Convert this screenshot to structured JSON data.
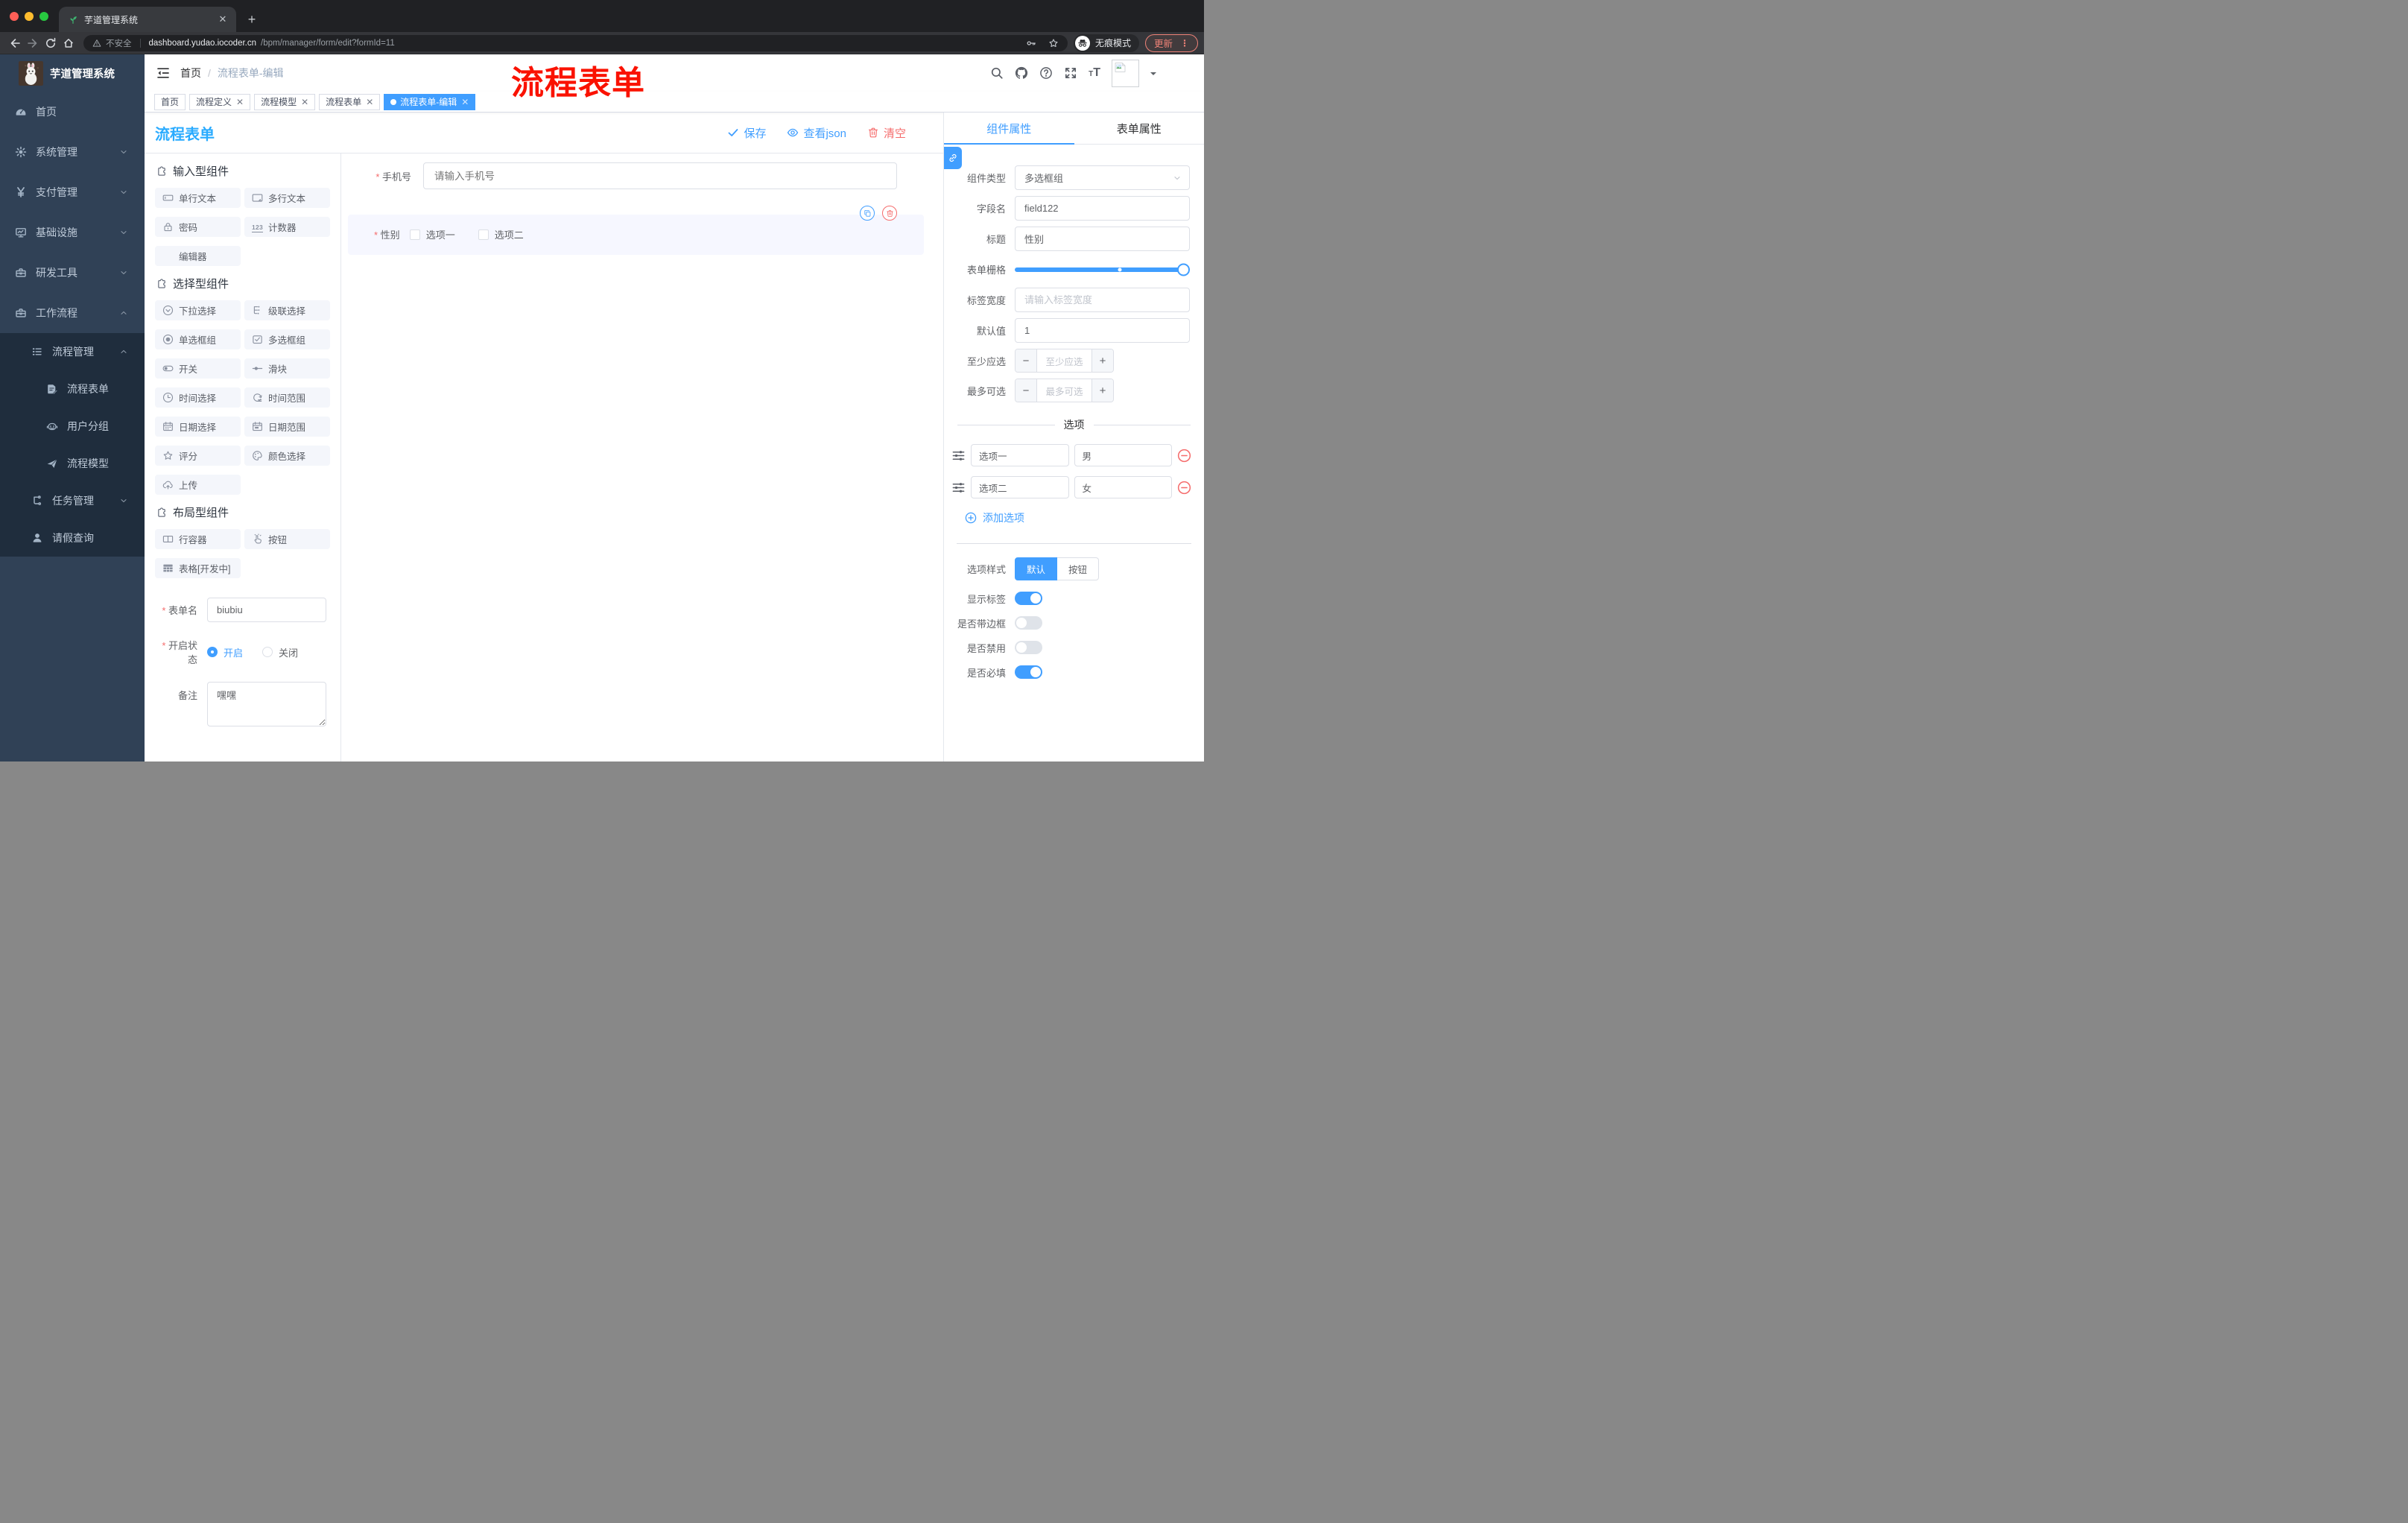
{
  "browser": {
    "tab_title": "芋道管理系统",
    "security_label": "不安全",
    "url_host": "dashboard.yudao.iocoder.cn",
    "url_path": "/bpm/manager/form/edit?formId=11",
    "incognito_label": "无痕模式",
    "update_label": "更新"
  },
  "sidebar": {
    "logo_title": "芋道管理系统",
    "items": [
      {
        "key": "home",
        "icon": "dashboard",
        "label": "首页",
        "level": 1
      },
      {
        "key": "system",
        "icon": "gear",
        "label": "系统管理",
        "level": 1,
        "arrow": "down"
      },
      {
        "key": "payment",
        "icon": "yen",
        "label": "支付管理",
        "level": 1,
        "arrow": "down"
      },
      {
        "key": "infra",
        "icon": "monitor",
        "label": "基础设施",
        "level": 1,
        "arrow": "down"
      },
      {
        "key": "devtools",
        "icon": "toolbox",
        "label": "研发工具",
        "level": 1,
        "arrow": "down"
      },
      {
        "key": "workflow",
        "icon": "toolbox",
        "label": "工作流程",
        "level": 1,
        "arrow": "up"
      },
      {
        "key": "process-mgmt",
        "icon": "listtree",
        "label": "流程管理",
        "level": 2,
        "sub": true,
        "arrow": "up"
      },
      {
        "key": "process-form",
        "icon": "docedit",
        "label": "流程表单",
        "level": 3,
        "sub": true
      },
      {
        "key": "user-group",
        "icon": "robot",
        "label": "用户分组",
        "level": 3,
        "sub": true
      },
      {
        "key": "process-model",
        "icon": "plane",
        "label": "流程模型",
        "level": 3,
        "sub": true
      },
      {
        "key": "task-mgmt",
        "icon": "tree",
        "label": "任务管理",
        "level": 2,
        "sub": true,
        "arrow": "down"
      },
      {
        "key": "leave-query",
        "icon": "person",
        "label": "请假查询",
        "level": 2,
        "sub": true
      }
    ]
  },
  "navbar": {
    "breadcrumb_home": "首页",
    "breadcrumb_current": "流程表单-编辑",
    "annotation": "流程表单"
  },
  "tags": {
    "items": [
      {
        "label": "首页",
        "closable": false,
        "active": false
      },
      {
        "label": "流程定义",
        "closable": true,
        "active": false
      },
      {
        "label": "流程模型",
        "closable": true,
        "active": false
      },
      {
        "label": "流程表单",
        "closable": true,
        "active": false
      },
      {
        "label": "流程表单-编辑",
        "closable": true,
        "active": true
      }
    ]
  },
  "content_header": {
    "title": "流程表单",
    "save_label": "保存",
    "view_json_label": "查看json",
    "clear_label": "清空"
  },
  "palette": {
    "sections": [
      {
        "title": "输入型组件",
        "items": [
          {
            "icon": "input",
            "label": "单行文本"
          },
          {
            "icon": "textarea",
            "label": "多行文本"
          },
          {
            "icon": "lock",
            "label": "密码"
          },
          {
            "icon": "counter",
            "label": "计数器"
          },
          {
            "icon": "",
            "label": "编辑器"
          }
        ]
      },
      {
        "title": "选择型组件",
        "items": [
          {
            "icon": "selectic",
            "label": "下拉选择"
          },
          {
            "icon": "cascader",
            "label": "级联选择"
          },
          {
            "icon": "radioic",
            "label": "单选框组"
          },
          {
            "icon": "checkboxic",
            "label": "多选框组"
          },
          {
            "icon": "switchic",
            "label": "开关"
          },
          {
            "icon": "slideric",
            "label": "滑块"
          },
          {
            "icon": "time",
            "label": "时间选择"
          },
          {
            "icon": "timerange",
            "label": "时间范围"
          },
          {
            "icon": "date",
            "label": "日期选择"
          },
          {
            "icon": "daterange",
            "label": "日期范围"
          },
          {
            "icon": "star",
            "label": "评分"
          },
          {
            "icon": "color",
            "label": "颜色选择"
          },
          {
            "icon": "upload",
            "label": "上传"
          }
        ]
      },
      {
        "title": "布局型组件",
        "items": [
          {
            "icon": "rowc",
            "label": "行容器"
          },
          {
            "icon": "click",
            "label": "按钮"
          },
          {
            "icon": "tableic",
            "label": "表格[开发中]"
          }
        ]
      }
    ],
    "form": {
      "name_label": "表单名",
      "name_value": "biubiu",
      "status_label": "开启状态",
      "status_on": "开启",
      "status_off": "关闭",
      "remark_label": "备注",
      "remark_value": "嘿嘿"
    }
  },
  "canvas": {
    "phone": {
      "label": "手机号",
      "placeholder": "请输入手机号"
    },
    "gender": {
      "label": "性别",
      "option1": "选项一",
      "option2": "选项二"
    }
  },
  "panel": {
    "tab_component": "组件属性",
    "tab_form": "表单属性",
    "type_label": "组件类型",
    "type_value": "多选框组",
    "field_label": "字段名",
    "field_value": "field122",
    "title_label": "标题",
    "title_value": "性别",
    "grid_label": "表单栅格",
    "label_width_label": "标签宽度",
    "label_width_placeholder": "请输入标签宽度",
    "default_label": "默认值",
    "default_value": "1",
    "min_label": "至少应选",
    "min_placeholder": "至少应选",
    "max_label": "最多可选",
    "max_placeholder": "最多可选",
    "options_title": "选项",
    "options": [
      {
        "label": "选项一",
        "value": "男"
      },
      {
        "label": "选项二",
        "value": "女"
      }
    ],
    "add_option_label": "添加选项",
    "style_label": "选项样式",
    "style_default": "默认",
    "style_button": "按钮",
    "toggles": [
      {
        "key": "show-label",
        "label": "显示标签",
        "on": true
      },
      {
        "key": "with-border",
        "label": "是否带边框",
        "on": false
      },
      {
        "key": "disabled",
        "label": "是否禁用",
        "on": false
      },
      {
        "key": "required",
        "label": "是否必填",
        "on": true
      }
    ]
  }
}
